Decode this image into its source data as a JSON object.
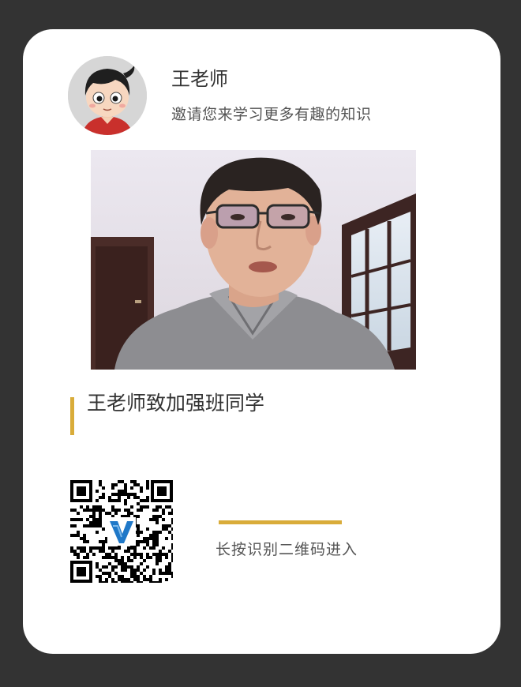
{
  "header": {
    "name": "王老师",
    "subtitle": "邀请您来学习更多有趣的知识"
  },
  "post": {
    "title": "王老师致加强班同学"
  },
  "qr_section": {
    "scan_hint": "长按识别二维码进入"
  },
  "colors": {
    "background": "#333333",
    "card": "#ffffff",
    "accent": "#d9ac3a"
  },
  "icons": {
    "avatar": "cartoon-boy-avatar",
    "qr_logo": "v-logo-icon"
  }
}
